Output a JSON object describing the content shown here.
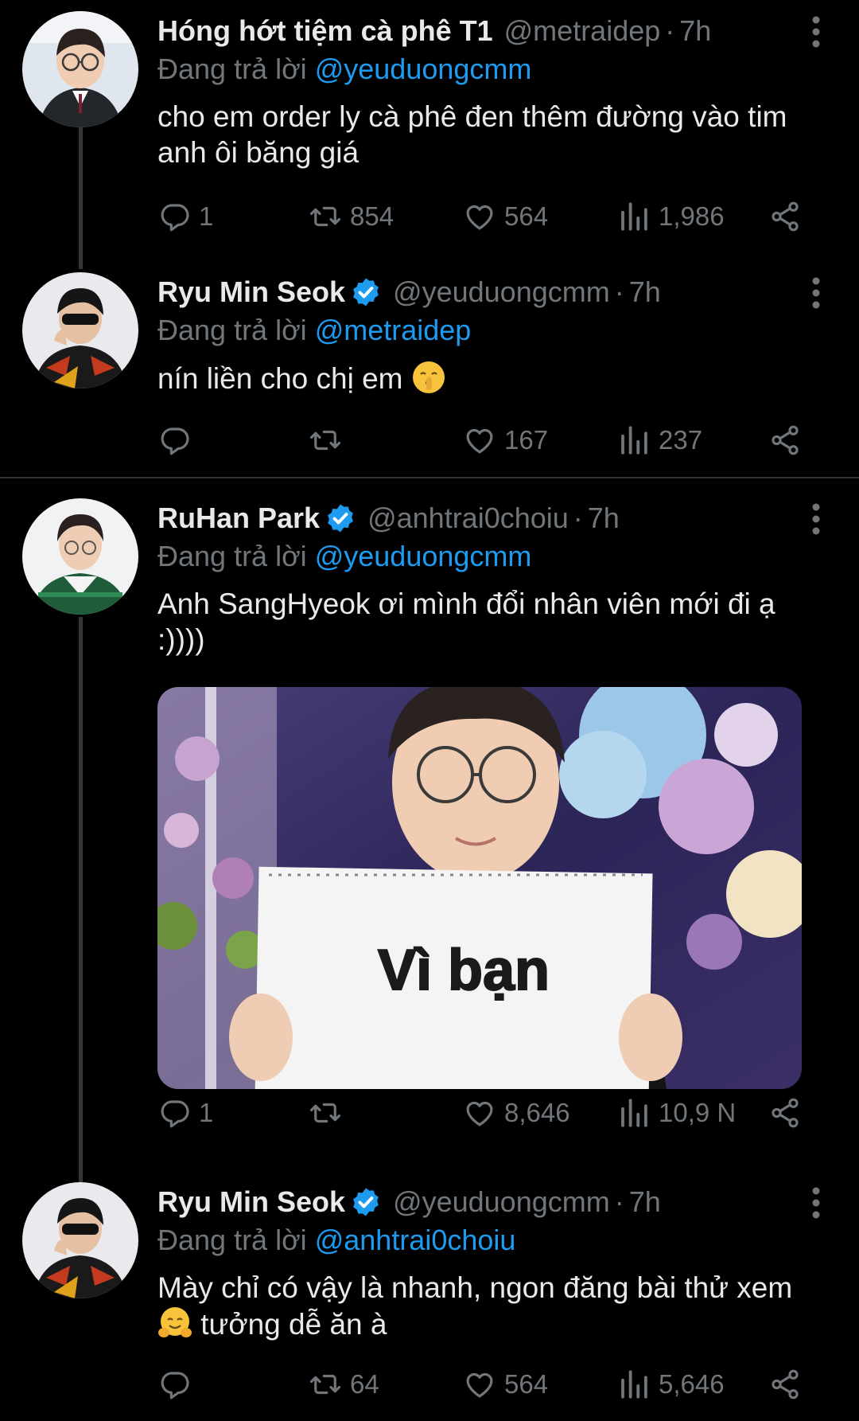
{
  "colors": {
    "background": "#000000",
    "text": "#e7e9ea",
    "muted": "#71767b",
    "link": "#1d9bf0",
    "verified": "#1d9bf0"
  },
  "tweets": [
    {
      "name": "Hóng hớt tiệm cà phê T1",
      "verified": false,
      "handle": "@metraidep",
      "sep": "·",
      "time": "7h",
      "replying_prefix": "Đang trả lời",
      "replying_to": "@yeuduongcmm",
      "text": "cho em order ly cà phê đen thêm đường vào tim anh ôi băng giá",
      "replies": "1",
      "retweets": "854",
      "likes": "564",
      "views": "1,986"
    },
    {
      "name": "Ryu Min Seok",
      "verified": true,
      "handle": "@yeuduongcmm",
      "sep": "·",
      "time": "7h",
      "replying_prefix": "Đang trả lời",
      "replying_to": "@metraidep",
      "text": "nín liền cho chị em",
      "emoji": "shushing-face-emoji",
      "replies": "",
      "retweets": "",
      "likes": "167",
      "views": "237"
    },
    {
      "name": "RuHan Park",
      "verified": true,
      "handle": "@anhtrai0choiu",
      "sep": "·",
      "time": "7h",
      "replying_prefix": "Đang trả lời",
      "replying_to": "@yeuduongcmm",
      "text": "Anh SangHyeok ơi mình đổi nhân viên mới đi ạ :))))",
      "media_caption": "Vì bạn",
      "replies": "1",
      "retweets": "",
      "likes": "8,646",
      "views": "10,9 N"
    },
    {
      "name": "Ryu Min Seok",
      "verified": true,
      "handle": "@yeuduongcmm",
      "sep": "·",
      "time": "7h",
      "replying_prefix": "Đang trả lời",
      "replying_to": "@anhtrai0choiu",
      "text_before_emoji": "Mày chỉ có vậy là nhanh, ngon đăng bài thử xem",
      "emoji": "hugging-face-emoji",
      "text_after_emoji": "tưởng dễ ăn à",
      "replies": "",
      "retweets": "64",
      "likes": "564",
      "views": "5,646"
    }
  ]
}
